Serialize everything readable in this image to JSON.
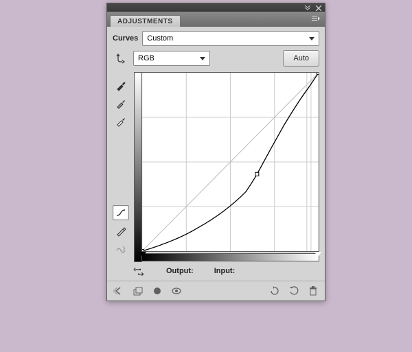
{
  "panel": {
    "tab_title": "ADJUSTMENTS",
    "section_label": "Curves",
    "preset_value": "Custom",
    "channel_value": "RGB",
    "auto_label": "Auto",
    "output_label": "Output:",
    "input_label": "Input:"
  },
  "chart_data": {
    "type": "line",
    "title": "",
    "xlabel": "Input",
    "ylabel": "Output",
    "xlim": [
      0,
      255
    ],
    "ylim": [
      0,
      255
    ],
    "grid": true,
    "series": [
      {
        "name": "diagonal-reference",
        "x": [
          0,
          255
        ],
        "values": [
          0,
          255
        ]
      },
      {
        "name": "curve",
        "x": [
          0,
          64,
          128,
          166,
          192,
          230,
          255
        ],
        "values": [
          0,
          22,
          60,
          110,
          160,
          225,
          255
        ]
      }
    ],
    "control_points": [
      {
        "x": 0,
        "y": 0
      },
      {
        "x": 166,
        "y": 110
      },
      {
        "x": 255,
        "y": 255
      }
    ],
    "black_slider": 0,
    "white_slider": 255
  },
  "colors": {
    "panel_bg": "#d4d4d4",
    "canvas_bg": "#cab9cc"
  }
}
